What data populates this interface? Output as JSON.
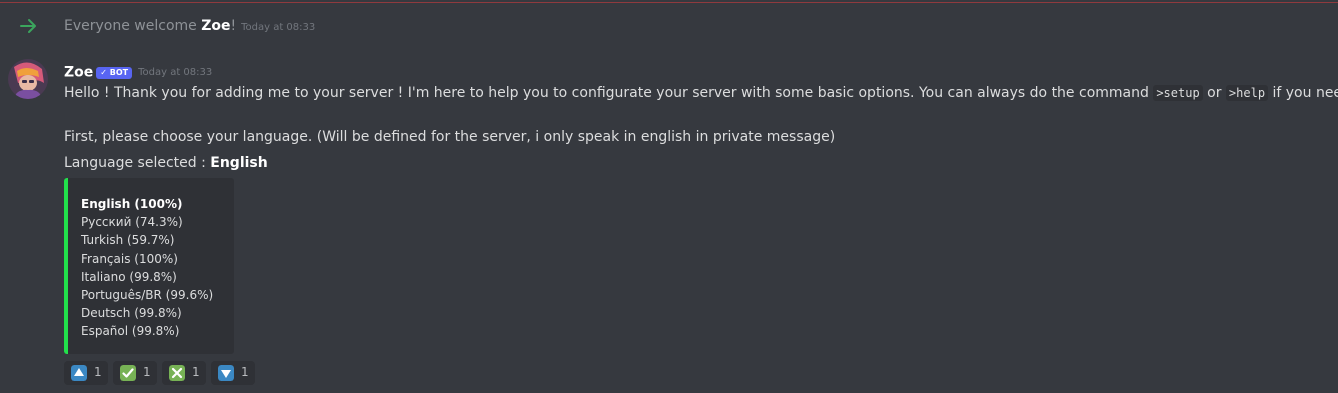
{
  "system_message": {
    "prefix": "Everyone welcome ",
    "username": "Zoe",
    "suffix": "!",
    "timestamp": "Today at 08:33"
  },
  "message": {
    "author": "Zoe",
    "bot_tag": "✓ BOT",
    "timestamp": "Today at 08:33",
    "line1_a": "Hello ! Thank you for adding me to your server ! I'm here to help you to configurate your server with some basic options. You can always do the command ",
    "code_setup": ">setup",
    "line1_b": " or ",
    "code_help": ">help",
    "line1_c": " if you need help.",
    "line2": "First, please choose your language. (Will be defined for the server, i only speak in english in private message)",
    "line3_prefix": "Language selected : ",
    "line3_value": "English"
  },
  "embed": {
    "accent_color": "#22e04b",
    "languages": [
      "English (100%)",
      "Русский (74.3%)",
      "Turkish (59.7%)",
      "Français (100%)",
      "Italiano (99.8%)",
      "Português/BR (99.6%)",
      "Deutsch (99.8%)",
      "Español (99.8%)"
    ]
  },
  "reactions": [
    {
      "icon": "arrow-up-icon",
      "count": "1"
    },
    {
      "icon": "check-mark-icon",
      "count": "1"
    },
    {
      "icon": "cross-mark-icon",
      "count": "1"
    },
    {
      "icon": "arrow-down-icon",
      "count": "1"
    }
  ]
}
